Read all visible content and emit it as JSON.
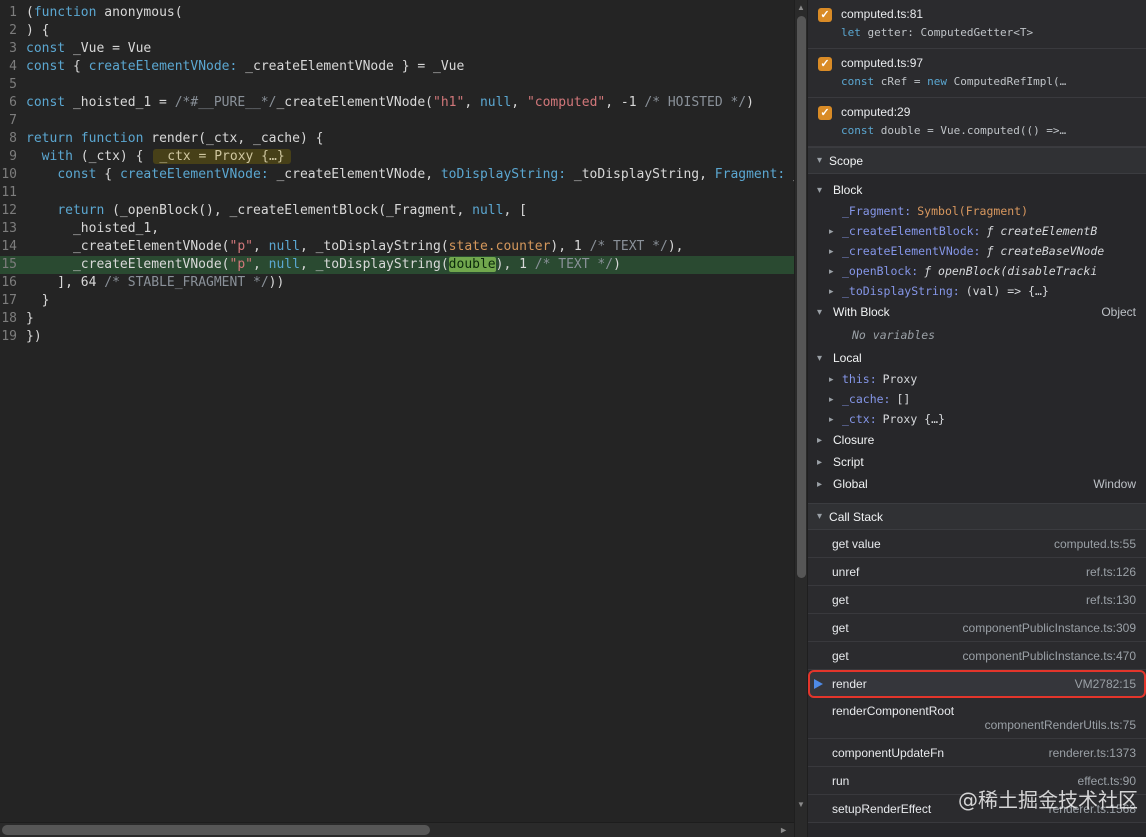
{
  "watermark": "@稀土掘金技术社区",
  "icons": {
    "check": "✓",
    "triangle_down": "▾",
    "triangle_right": "▸",
    "scroll_up": "▲",
    "scroll_down": "▼",
    "scroll_right": "►"
  },
  "editor": {
    "lines": [
      {
        "n": 1,
        "current": false,
        "t": [
          [
            "plain",
            "("
          ],
          [
            "kw",
            "function"
          ],
          [
            "plain",
            " anonymous("
          ]
        ]
      },
      {
        "n": 2,
        "current": false,
        "t": [
          [
            "plain",
            ") {"
          ]
        ]
      },
      {
        "n": 3,
        "current": false,
        "t": [
          [
            "kw",
            "const"
          ],
          [
            "plain",
            " _Vue = Vue"
          ]
        ]
      },
      {
        "n": 4,
        "current": false,
        "t": [
          [
            "kw",
            "const"
          ],
          [
            "plain",
            " { "
          ],
          [
            "prop",
            "createElementVNode:"
          ],
          [
            "plain",
            " _createElementVNode } = _Vue"
          ]
        ]
      },
      {
        "n": 5,
        "current": false,
        "t": [
          [
            "plain",
            ""
          ]
        ]
      },
      {
        "n": 6,
        "current": false,
        "t": [
          [
            "kw",
            "const"
          ],
          [
            "plain",
            " _hoisted_1 = "
          ],
          [
            "cmt",
            "/*#__PURE__*/"
          ],
          [
            "plain",
            "_createElementVNode("
          ],
          [
            "str",
            "\"h1\""
          ],
          [
            "plain",
            ", "
          ],
          [
            "kw",
            "null"
          ],
          [
            "plain",
            ", "
          ],
          [
            "str",
            "\"computed\""
          ],
          [
            "plain",
            ", -1 "
          ],
          [
            "cmt",
            "/* HOISTED */"
          ],
          [
            "plain",
            ")"
          ]
        ]
      },
      {
        "n": 7,
        "current": false,
        "t": [
          [
            "plain",
            ""
          ]
        ]
      },
      {
        "n": 8,
        "current": false,
        "t": [
          [
            "kw",
            "return"
          ],
          [
            "plain",
            " "
          ],
          [
            "kw",
            "function"
          ],
          [
            "plain",
            " render(_ctx, _cache) {"
          ]
        ]
      },
      {
        "n": 9,
        "current": false,
        "t": [
          [
            "plain",
            "  "
          ],
          [
            "kw",
            "with"
          ],
          [
            "plain",
            " (_ctx) {"
          ],
          [
            "hint",
            "_ctx = Proxy {…}"
          ]
        ]
      },
      {
        "n": 10,
        "current": false,
        "t": [
          [
            "plain",
            "    "
          ],
          [
            "kw",
            "const"
          ],
          [
            "plain",
            " { "
          ],
          [
            "prop",
            "createElementVNode:"
          ],
          [
            "plain",
            " _createElementVNode, "
          ],
          [
            "prop",
            "toDisplayString:"
          ],
          [
            "plain",
            " _toDisplayString, "
          ],
          [
            "prop",
            "Fragment:"
          ],
          [
            "plain",
            " _Fragment } = _Vue"
          ]
        ]
      },
      {
        "n": 11,
        "current": false,
        "t": [
          [
            "plain",
            ""
          ]
        ]
      },
      {
        "n": 12,
        "current": false,
        "t": [
          [
            "plain",
            "    "
          ],
          [
            "kw",
            "return"
          ],
          [
            "plain",
            " (_openBlock(), _createElementBlock(_Fragment, "
          ],
          [
            "kw",
            "null"
          ],
          [
            "plain",
            ", ["
          ]
        ]
      },
      {
        "n": 13,
        "current": false,
        "t": [
          [
            "plain",
            "      _hoisted_1,"
          ]
        ]
      },
      {
        "n": 14,
        "current": false,
        "t": [
          [
            "plain",
            "      _createElementVNode("
          ],
          [
            "str",
            "\"p\""
          ],
          [
            "plain",
            ", "
          ],
          [
            "kw",
            "null"
          ],
          [
            "plain",
            ", _toDisplayString("
          ],
          [
            "tan",
            "state.counter"
          ],
          [
            "plain",
            "), 1 "
          ],
          [
            "cmt",
            "/* TEXT */"
          ],
          [
            "plain",
            "),"
          ]
        ]
      },
      {
        "n": 15,
        "current": true,
        "t": [
          [
            "plain",
            "      _createElementVNode("
          ],
          [
            "str",
            "\"p\""
          ],
          [
            "plain",
            ", "
          ],
          [
            "kw",
            "null"
          ],
          [
            "plain",
            ", _toDisplayString("
          ],
          [
            "exec",
            "double"
          ],
          [
            "plain",
            "), 1 "
          ],
          [
            "cmt",
            "/* TEXT */"
          ],
          [
            "plain",
            ")"
          ]
        ]
      },
      {
        "n": 16,
        "current": false,
        "t": [
          [
            "plain",
            "    ], 64 "
          ],
          [
            "cmt",
            "/* STABLE_FRAGMENT */"
          ],
          [
            "plain",
            "))"
          ]
        ]
      },
      {
        "n": 17,
        "current": false,
        "t": [
          [
            "plain",
            "  }"
          ]
        ]
      },
      {
        "n": 18,
        "current": false,
        "t": [
          [
            "plain",
            "}"
          ]
        ]
      },
      {
        "n": 19,
        "current": false,
        "t": [
          [
            "plain",
            "})"
          ]
        ]
      }
    ]
  },
  "sidebar": {
    "breakpoints": [
      {
        "location": "computed.ts:81",
        "code": [
          [
            "kw",
            "let"
          ],
          [
            "plain",
            " getter: ComputedGetter<T>"
          ]
        ]
      },
      {
        "location": "computed.ts:97",
        "code": [
          [
            "kw",
            "const"
          ],
          [
            "plain",
            " cRef = "
          ],
          [
            "kw",
            "new"
          ],
          [
            "plain",
            " ComputedRefImpl(…"
          ]
        ]
      },
      {
        "location": "computed:29",
        "code": [
          [
            "kw",
            "const"
          ],
          [
            "plain",
            " double = Vue.computed(() =>…"
          ]
        ]
      }
    ],
    "scope": {
      "title": "Scope",
      "groups": [
        {
          "label": "Block",
          "expanded": true,
          "right": "",
          "items": [
            {
              "expandable": false,
              "name": "_Fragment",
              "value": "Symbol(Fragment)",
              "vtype": "symbol"
            },
            {
              "expandable": true,
              "name": "_createElementBlock",
              "value": "ƒ createElementB",
              "vtype": "func"
            },
            {
              "expandable": true,
              "name": "_createElementVNode",
              "value": "ƒ createBaseVNode",
              "vtype": "func"
            },
            {
              "expandable": true,
              "name": "_openBlock",
              "value": "ƒ openBlock(disableTracki",
              "vtype": "func"
            },
            {
              "expandable": true,
              "name": "_toDisplayString",
              "value": "(val) => {…}",
              "vtype": "plain"
            }
          ]
        },
        {
          "label": "With Block",
          "expanded": true,
          "right": "Object",
          "empty": "No variables",
          "items": []
        },
        {
          "label": "Local",
          "expanded": true,
          "right": "",
          "items": [
            {
              "expandable": true,
              "name": "this",
              "value": "Proxy",
              "vtype": "plain"
            },
            {
              "expandable": true,
              "name": "_cache",
              "value": "[]",
              "vtype": "plain"
            },
            {
              "expandable": true,
              "name": "_ctx",
              "value": "Proxy {…}",
              "vtype": "plain"
            }
          ]
        },
        {
          "label": "Closure",
          "expanded": false,
          "right": "",
          "items": []
        },
        {
          "label": "Script",
          "expanded": false,
          "right": "",
          "items": []
        },
        {
          "label": "Global",
          "expanded": false,
          "right": "Window",
          "items": []
        }
      ]
    },
    "callstack": {
      "title": "Call Stack",
      "frames": [
        {
          "fn": "get value",
          "loc": "computed.ts:55"
        },
        {
          "fn": "unref",
          "loc": "ref.ts:126"
        },
        {
          "fn": "get",
          "loc": "ref.ts:130"
        },
        {
          "fn": "get",
          "loc": "componentPublicInstance.ts:309"
        },
        {
          "fn": "get",
          "loc": "componentPublicInstance.ts:470"
        },
        {
          "fn": "render",
          "loc": "VM2782:15",
          "active": true,
          "annotated": true
        },
        {
          "fn": "renderComponentRoot",
          "loc": "componentRenderUtils.ts:75",
          "wrap": true
        },
        {
          "fn": "componentUpdateFn",
          "loc": "renderer.ts:1373"
        },
        {
          "fn": "run",
          "loc": "effect.ts:90"
        },
        {
          "fn": "setupRenderEffect",
          "loc": "renderer.ts:1568"
        }
      ]
    }
  }
}
